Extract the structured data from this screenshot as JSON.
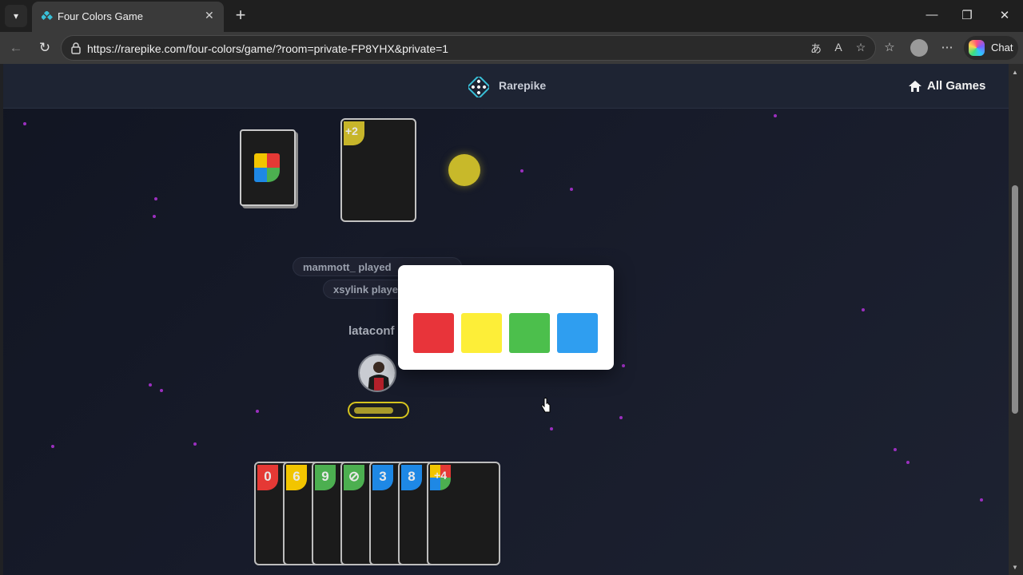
{
  "browser": {
    "tab_title": "Four Colors Game",
    "tab_close": "✕",
    "new_tab": "+",
    "url": "https://rarepike.com/four-colors/game/?room=private-FP8YHX&private=1",
    "chat_label": "Chat",
    "window_controls": {
      "minimize": "—",
      "restore": "❐",
      "close": "✕"
    }
  },
  "site": {
    "brand": "Rarepike",
    "nav_all_games": "All Games"
  },
  "game": {
    "discard_card": {
      "label": "+2",
      "color": "#c7b52a"
    },
    "current_color": "#c8b92a",
    "log": [
      "mammott_ played",
      "xsylink playe"
    ],
    "current_player": "lataconf",
    "turn_timer": 0.8,
    "hand": [
      {
        "label": "0",
        "color": "#e53935"
      },
      {
        "label": "6",
        "color": "#f2c500"
      },
      {
        "label": "9",
        "color": "#4caf50"
      },
      {
        "label": "⊘",
        "color": "#4caf50"
      },
      {
        "label": "3",
        "color": "#1e88e5"
      },
      {
        "label": "8",
        "color": "#1e88e5"
      },
      {
        "label": "+4",
        "color": "wild"
      }
    ],
    "color_picker": {
      "options": [
        {
          "name": "red",
          "color": "#e8343a"
        },
        {
          "name": "yellow",
          "color": "#fdee38"
        },
        {
          "name": "green",
          "color": "#4cbf4c"
        },
        {
          "name": "blue",
          "color": "#2f9ef0"
        }
      ]
    }
  }
}
